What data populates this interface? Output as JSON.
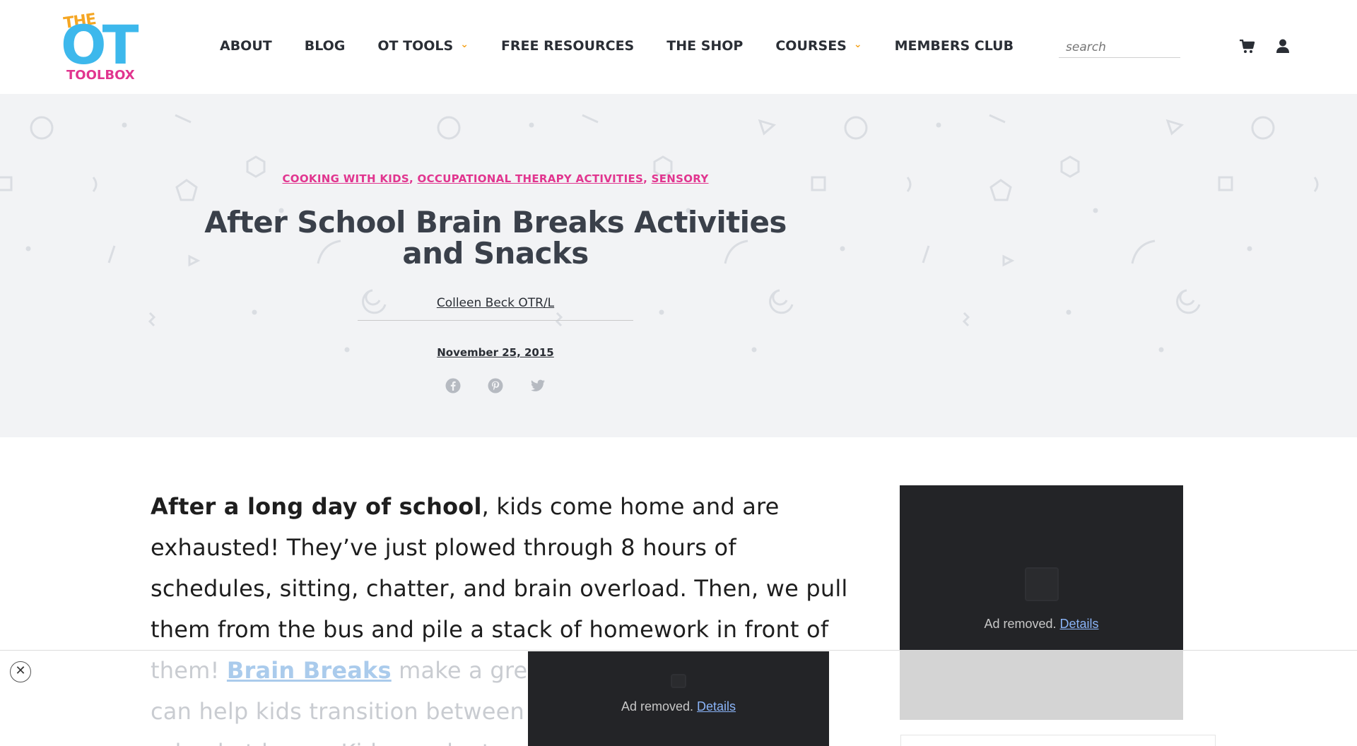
{
  "header": {
    "logo": {
      "the": "THE",
      "ot": "OT",
      "toolbox": "TOOLBOX"
    },
    "nav": [
      {
        "label": "ABOUT",
        "dropdown": false
      },
      {
        "label": "BLOG",
        "dropdown": false
      },
      {
        "label": "OT TOOLS",
        "dropdown": true
      },
      {
        "label": "FREE RESOURCES",
        "dropdown": false
      },
      {
        "label": "THE SHOP",
        "dropdown": false
      },
      {
        "label": "COURSES",
        "dropdown": true
      },
      {
        "label": "MEMBERS CLUB",
        "dropdown": false
      }
    ],
    "search_placeholder": "search",
    "icons": {
      "cart": "shopping-cart-icon",
      "account": "user-icon"
    }
  },
  "hero": {
    "categories": [
      "COOKING WITH KIDS",
      "OCCUPATIONAL THERAPY ACTIVITIES",
      "SENSORY"
    ],
    "title": "After School Brain Breaks Activities and Snacks",
    "author": "Colleen Beck OTR/L",
    "date": "November 25, 2015",
    "share_icons": [
      "facebook-icon",
      "pinterest-icon",
      "twitter-icon"
    ]
  },
  "article": {
    "lead_bold": "After a long day of school",
    "lead_rest": ", kids come home and are exhausted! They’ve just plowed through 8 hours of schedules, sitting, chatter, and brain overload. Then, we pull them from the bus and pile a stack of homework in front of",
    "faded_start": "them! ",
    "faded_link": "Brain Breaks",
    "faded_rest": " make a gre",
    "faded_line2": "can help kids transition between",
    "faded_line3": "school at home. Kids need a tran"
  },
  "ads": {
    "removed_text": "Ad removed.",
    "details_link": "Details"
  },
  "colors": {
    "brand_pink": "#e1358f",
    "brand_blue": "#3db8ec",
    "brand_orange": "#f5a623",
    "hero_bg": "#f2f3f5",
    "ad_bg": "#232427"
  }
}
